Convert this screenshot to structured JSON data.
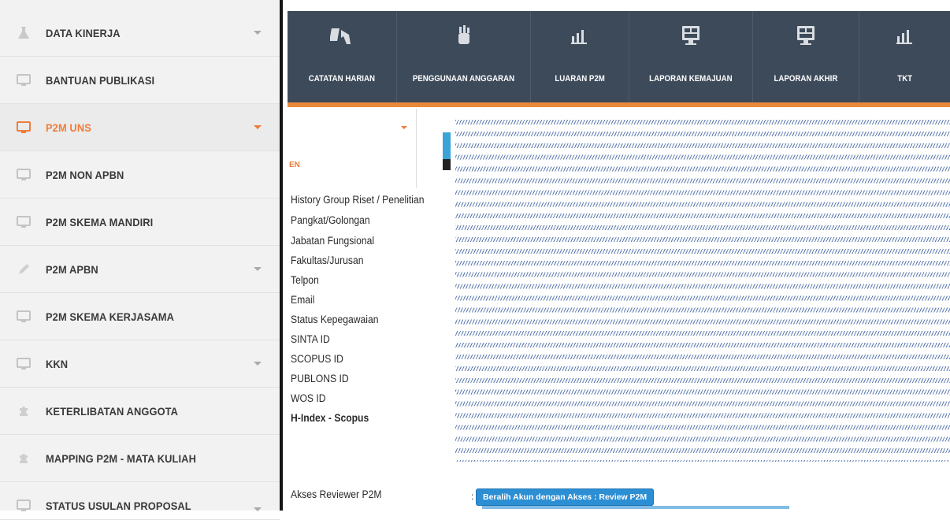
{
  "sidebar": {
    "items": [
      {
        "label": "DATA KINERJA",
        "icon": "flask-icon",
        "has_caret": true,
        "active": false
      },
      {
        "label": "BANTUAN PUBLIKASI",
        "icon": "monitor-icon",
        "has_caret": false,
        "active": false
      },
      {
        "label": "P2M UNS",
        "icon": "monitor-icon",
        "has_caret": true,
        "active": true
      },
      {
        "label": "P2M NON APBN",
        "icon": "monitor-icon",
        "has_caret": false,
        "active": false
      },
      {
        "label": "P2M SKEMA MANDIRI",
        "icon": "monitor-icon",
        "has_caret": false,
        "active": false
      },
      {
        "label": "P2M APBN",
        "icon": "pencil-icon",
        "has_caret": true,
        "active": false
      },
      {
        "label": "P2M SKEMA KERJASAMA",
        "icon": "monitor-icon",
        "has_caret": false,
        "active": false
      },
      {
        "label": "KKN",
        "icon": "monitor-icon",
        "has_caret": true,
        "active": false
      },
      {
        "label": "KETERLIBATAN ANGGOTA",
        "icon": "puzzle-icon",
        "has_caret": false,
        "active": false
      },
      {
        "label": "MAPPING P2M - MATA KULIAH",
        "icon": "puzzle-icon",
        "has_caret": false,
        "active": false
      },
      {
        "label": "STATUS USULAN PROPOSAL",
        "icon": "monitor-icon",
        "has_caret": true,
        "active": false
      }
    ],
    "accent_color": "#f07c3a"
  },
  "toolbar": {
    "items": [
      {
        "label": "CATATAN HARIAN",
        "icon": "hand-pointer-icon"
      },
      {
        "label": "PENGGUNAAN ANGGARAN",
        "icon": "money-jar-icon"
      },
      {
        "label": "LUARAN P2M",
        "icon": "bar-chart-icon"
      },
      {
        "label": "LAPORAN KEMAJUAN",
        "icon": "monitor-report-icon"
      },
      {
        "label": "LAPORAN AKHIR",
        "icon": "monitor-report-icon"
      },
      {
        "label": "TKT",
        "icon": "bar-chart-icon"
      }
    ],
    "background_color": "#3d4a5a",
    "accent_color": "#e98a3a"
  },
  "content": {
    "section_tag": "EN",
    "fields": [
      "History Group Riset / Penelitian",
      "Pangkat/Golongan",
      "Jabatan Fungsional",
      "Fakultas/Jurusan",
      "Telpon",
      "Email",
      "Status Kepegawaian",
      "SINTA ID",
      "SCOPUS ID",
      "PUBLONS ID",
      "WOS ID",
      "H-Index - Scopus"
    ],
    "reviewer": {
      "label": "Akses Reviewer P2M",
      "colon": ":",
      "button_label": "Beralih Akun dengan Akses : Review P2M"
    }
  }
}
